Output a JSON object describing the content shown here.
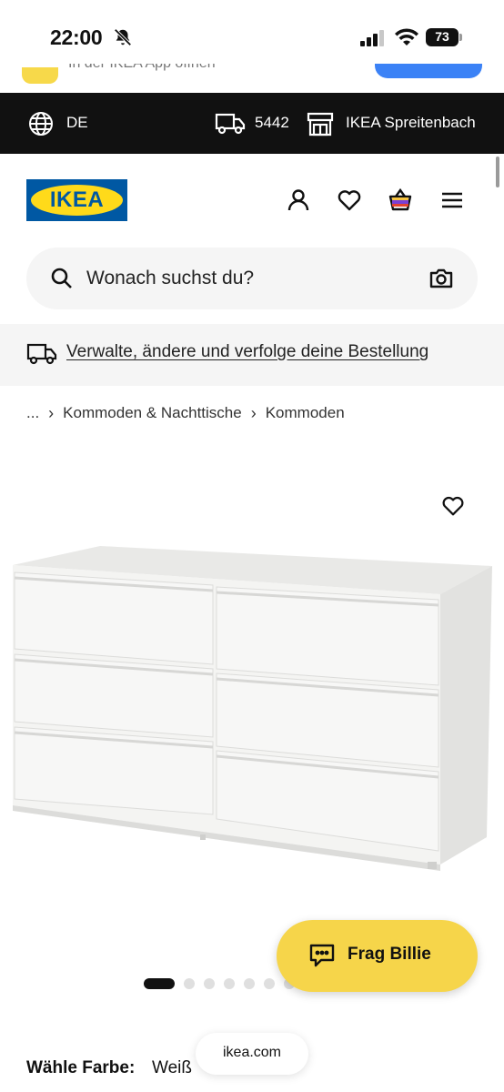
{
  "status_bar": {
    "time": "22:00",
    "battery": "73"
  },
  "app_banner": {
    "text": "In der IKEA App öffnen"
  },
  "topbar": {
    "country": "DE",
    "postal_code": "5442",
    "store": "IKEA Spreitenbach"
  },
  "header": {
    "logo_text": "IKEA",
    "brand_colors": {
      "blue": "#0058a3",
      "yellow": "#ffda1a"
    }
  },
  "search": {
    "placeholder": "Wonach suchst du?"
  },
  "order_strip": {
    "link": "Verwalte, ändere und verfolge deine Bestellung"
  },
  "breadcrumb": {
    "ellipsis": "...",
    "items": [
      "Kommoden & Nachttische",
      "Kommoden"
    ]
  },
  "gallery": {
    "dot_count": 8,
    "active_index": 0
  },
  "chat": {
    "label": "Frag Billie",
    "color": "#f6d54a"
  },
  "product": {
    "color_label": "Wähle Farbe:",
    "color_value": "Weiß"
  },
  "browser": {
    "url": "ikea.com"
  }
}
